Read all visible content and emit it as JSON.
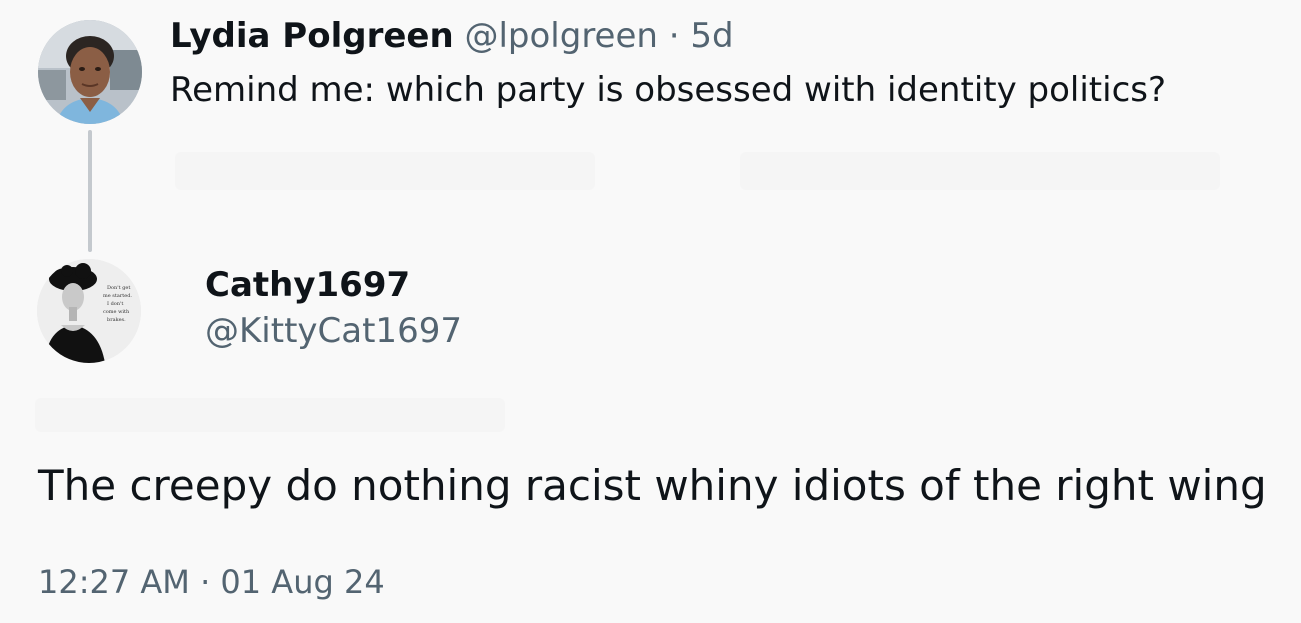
{
  "original_tweet": {
    "display_name": "Lydia Polgreen",
    "handle": "@lpolgreen",
    "separator": "·",
    "time_ago": "5d",
    "text": "Remind me: which party is obsessed with identity politics?",
    "avatar_icon": "person-photo-avatar"
  },
  "reply_tweet": {
    "display_name": "Cathy1697",
    "handle": "@KittyCat1697",
    "text": "The creepy do nothing racist whiny idiots of the right wing",
    "time": "12:27 AM",
    "separator": "·",
    "date": "01 Aug 24",
    "avatar_icon": "vintage-woman-hat-avatar",
    "avatar_caption": "Don't get me started. I don't come with brakes."
  },
  "colors": {
    "background": "#f9f9f9",
    "text_primary": "#0f1419",
    "text_secondary": "#536471",
    "thread_line": "#c4c9ce"
  }
}
